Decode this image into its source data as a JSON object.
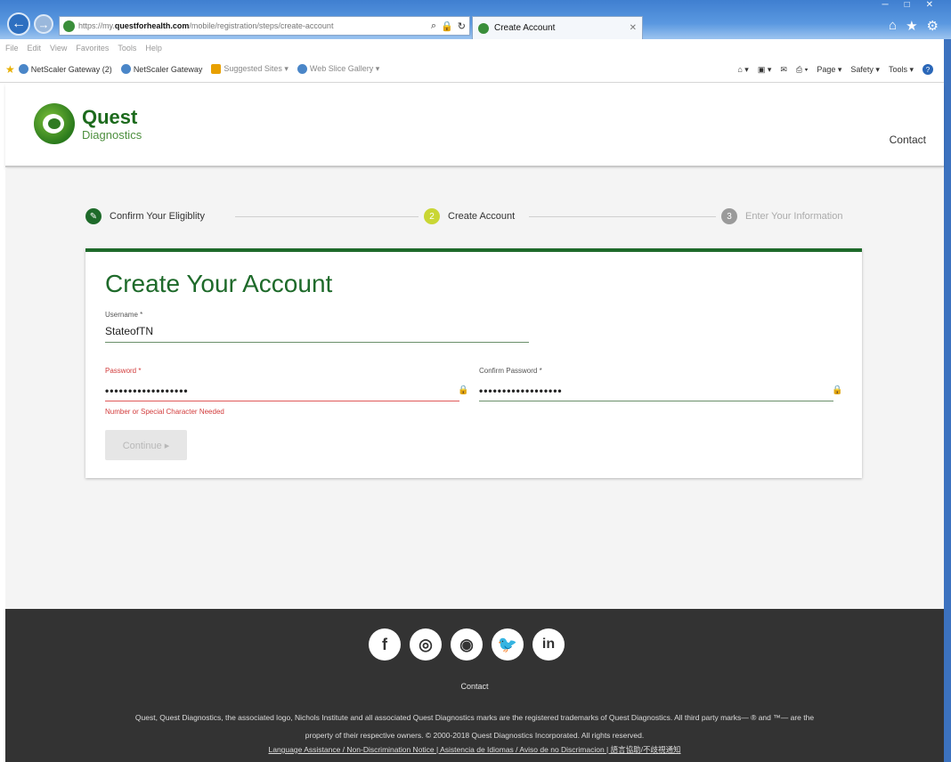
{
  "browser": {
    "url_prefix": "https://my.",
    "url_domain": "questforhealth.com",
    "url_path": "/mobile/registration/steps/create-account",
    "tab_title": "Create Account",
    "menu": [
      "File",
      "Edit",
      "View",
      "Favorites",
      "Tools",
      "Help"
    ],
    "favorites": [
      {
        "label": "NetScaler Gateway (2)",
        "icon": "netscaler-icon"
      },
      {
        "label": "NetScaler Gateway",
        "icon": "netscaler-icon"
      },
      {
        "label": "Suggested Sites ▾",
        "icon": "bing-icon"
      },
      {
        "label": "Web Slice Gallery ▾",
        "icon": "web-slice-icon"
      }
    ],
    "commands": [
      "Page ▾",
      "Safety ▾",
      "Tools ▾"
    ]
  },
  "header": {
    "logo_name": "Quest",
    "logo_sub": "Diagnostics",
    "contact_label": "Contact"
  },
  "stepper": {
    "steps": [
      {
        "label": "Confirm Your Eligiblity",
        "marker": "✎",
        "status": "done"
      },
      {
        "label": "Create Account",
        "marker": "2",
        "status": "current"
      },
      {
        "label": "Enter Your Information",
        "marker": "3",
        "status": "upcoming"
      }
    ]
  },
  "form": {
    "title": "Create Your Account",
    "username_label": "Username *",
    "username_value": "StateofTN",
    "password_label": "Password *",
    "password_value": "••••••••••••••••••",
    "password_error": "Number or Special Character Needed",
    "confirm_label": "Confirm Password *",
    "confirm_value": "••••••••••••••••••",
    "continue_label": "Continue ▸"
  },
  "footer": {
    "social": [
      {
        "icon": "facebook-icon",
        "glyph": "f"
      },
      {
        "icon": "instagram-icon",
        "glyph": "◎"
      },
      {
        "icon": "rss-icon",
        "glyph": "◉"
      },
      {
        "icon": "twitter-icon",
        "glyph": "🐦"
      },
      {
        "icon": "linkedin-icon",
        "glyph": "in"
      }
    ],
    "contact_label": "Contact",
    "legal_line1": "Quest, Quest Diagnostics, the associated logo, Nichols Institute and all associated Quest Diagnostics marks are the registered trademarks of Quest Diagnostics. All third party marks— ® and ™— are the",
    "legal_line2": "property of their respective owners. © 2000-2018 Quest Diagnostics Incorporated. All rights reserved.",
    "links": "Language Assistance / Non-Discrimination Notice | Asistencia de Idiomas / Aviso de no Discrimacion | 語言協助/不歧視通知"
  },
  "colors": {
    "brand_green": "#1e6a2a",
    "error_red": "#d23c3c",
    "footer_bg": "#333333"
  }
}
